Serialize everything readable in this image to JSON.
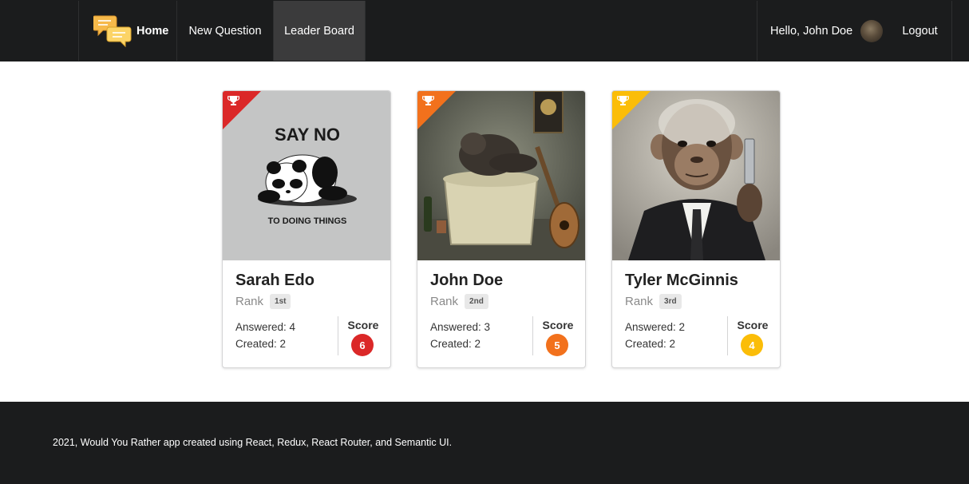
{
  "nav": {
    "home_label": "Home",
    "new_question_label": "New Question",
    "leaderboard_label": "Leader Board",
    "greeting": "Hello, John Doe",
    "logout_label": "Logout",
    "logo_icon": "chat-bubbles-icon"
  },
  "colors": {
    "first": "#db2828",
    "second": "#f2711c",
    "third": "#fbbd08",
    "nav_bg": "#1b1c1d"
  },
  "leaderboard": [
    {
      "name": "Sarah Edo",
      "rank_label": "Rank",
      "rank": "1st",
      "answered": "Answered: 4",
      "created": "Created: 2",
      "score_label": "Score",
      "score": "6",
      "avatar_text_1": "SAY NO",
      "avatar_text_2": "TO DOING THINGS",
      "ribbon_icon": "trophy-icon"
    },
    {
      "name": "John Doe",
      "rank_label": "Rank",
      "rank": "2nd",
      "answered": "Answered: 3",
      "created": "Created: 2",
      "score_label": "Score",
      "score": "5",
      "ribbon_icon": "trophy-icon"
    },
    {
      "name": "Tyler McGinnis",
      "rank_label": "Rank",
      "rank": "3rd",
      "answered": "Answered: 2",
      "created": "Created: 2",
      "score_label": "Score",
      "score": "4",
      "ribbon_icon": "trophy-icon"
    }
  ],
  "footer": {
    "text": "2021, Would You Rather app created using React, Redux, React Router, and Semantic UI."
  }
}
